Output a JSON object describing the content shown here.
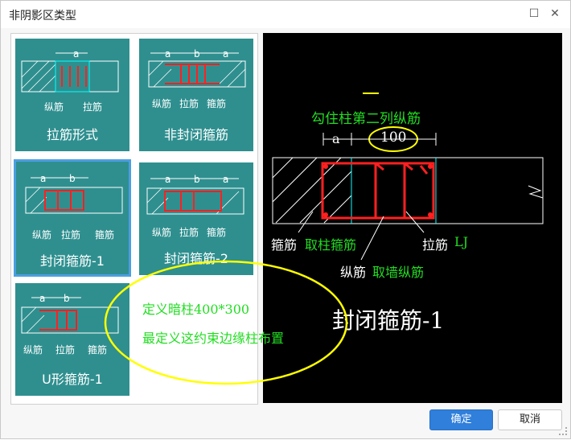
{
  "window": {
    "title": "非阴影区类型"
  },
  "tiles": [
    {
      "label": "拉筋形式",
      "dims": [
        "a"
      ],
      "parts": [
        "纵筋",
        "拉筋"
      ]
    },
    {
      "label": "非封闭箍筋",
      "dims": [
        "a",
        "b",
        "a"
      ],
      "parts": [
        "纵筋",
        "拉筋",
        "箍筋"
      ]
    },
    {
      "label": "封闭箍筋-1",
      "dims": [
        "a",
        "b"
      ],
      "parts": [
        "纵筋",
        "拉筋",
        "箍筋"
      ]
    },
    {
      "label": "封闭箍筋-2",
      "dims": [
        "a",
        "b",
        "a"
      ],
      "parts": [
        "纵筋",
        "拉筋",
        "箍筋"
      ]
    },
    {
      "label": "U形箍筋-1",
      "dims": [
        "a",
        "b"
      ],
      "parts": [
        "纵筋",
        "拉筋",
        "箍筋"
      ]
    }
  ],
  "note": {
    "line1": "定义暗柱400*300",
    "line2": "最定义这约束边缘柱布置"
  },
  "preview": {
    "title": "封闭箍筋-1",
    "annot_top": "勾住柱第二列纵筋",
    "dim_a": "a",
    "dim_value": "100",
    "stirrup_label": "箍筋",
    "stirrup_note": "取柱箍筋",
    "tie_label": "拉筋",
    "tie_note": "LJ",
    "long_label": "纵筋",
    "long_note": "取墙纵筋"
  },
  "buttons": {
    "ok": "确定",
    "cancel": "取消"
  },
  "colors": {
    "tile": "#2f8f8f",
    "accent": "#2f7fdb",
    "selection": "#4a9fe0",
    "rebar": "#ff2020",
    "highlight": "#ffff00",
    "annot": "#22dd22"
  }
}
